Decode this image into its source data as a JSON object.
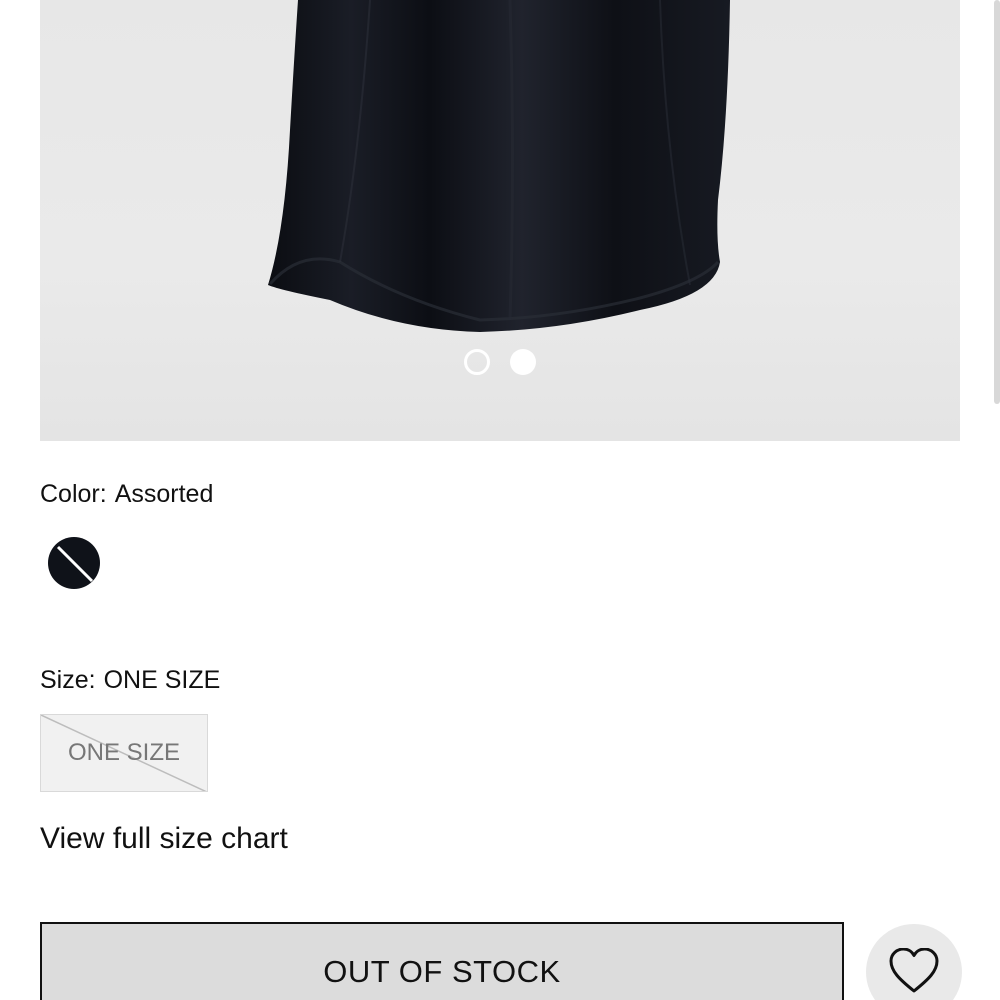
{
  "color": {
    "label": "Color:",
    "value": "Assorted",
    "swatch_color": "#0f1219"
  },
  "size": {
    "label": "Size:",
    "value": "ONE SIZE",
    "option_label": "ONE SIZE"
  },
  "size_chart_link": "View full size chart",
  "cta": {
    "label": "OUT OF STOCK"
  },
  "carousel": {
    "total": 2,
    "active_index": 0
  },
  "icons": {
    "wishlist": "heart-icon",
    "unavailable": "strikethrough-icon"
  }
}
